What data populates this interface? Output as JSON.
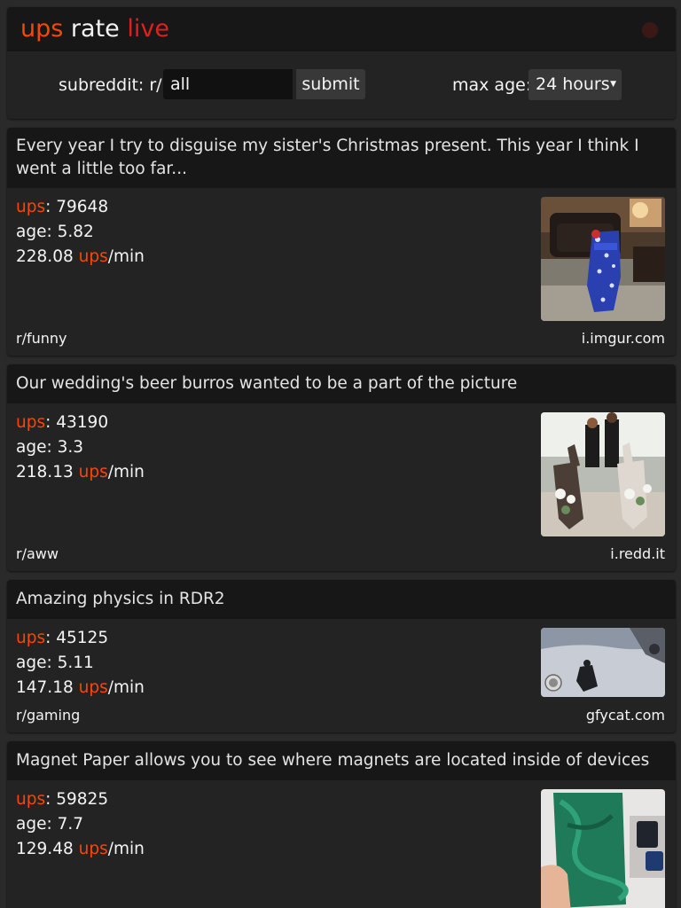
{
  "header": {
    "title_ups": "ups",
    "title_rate": "rate",
    "title_live": "live",
    "subreddit_label": "subreddit: r/",
    "subreddit_value": "all",
    "submit_label": "submit",
    "max_age_label": "max age:",
    "max_age_value": "24 hours"
  },
  "labels": {
    "ups": "ups",
    "age": "age:",
    "per_min": "/min"
  },
  "posts": [
    {
      "title": "Every year I try to disguise my sister's Christmas present. This year I think I went a little too far...",
      "ups": "79648",
      "age": "5.82",
      "rate": "228.08",
      "subreddit": "r/funny",
      "domain": "i.imgur.com",
      "thumb_icon": "living-room-gift-thumbnail"
    },
    {
      "title": "Our wedding's beer burros wanted to be a part of the picture",
      "ups": "43190",
      "age": "3.3",
      "rate": "218.13",
      "subreddit": "r/aww",
      "domain": "i.redd.it",
      "thumb_icon": "wedding-donkeys-thumbnail"
    },
    {
      "title": "Amazing physics in RDR2",
      "ups": "45125",
      "age": "5.11",
      "rate": "147.18",
      "subreddit": "r/gaming",
      "domain": "gfycat.com",
      "thumb_icon": "snowy-game-scene-thumbnail"
    },
    {
      "title": "Magnet Paper allows you to see where magnets are located inside of devices",
      "ups": "59825",
      "age": "7.7",
      "rate": "129.48",
      "subreddit": "",
      "domain": "",
      "thumb_icon": "magnet-paper-thumbnail"
    }
  ],
  "colors": {
    "accent": "#ff4500",
    "live": "#e0201c",
    "background": "#2a2a2a",
    "card": "#232323",
    "title_bar": "#171717"
  }
}
